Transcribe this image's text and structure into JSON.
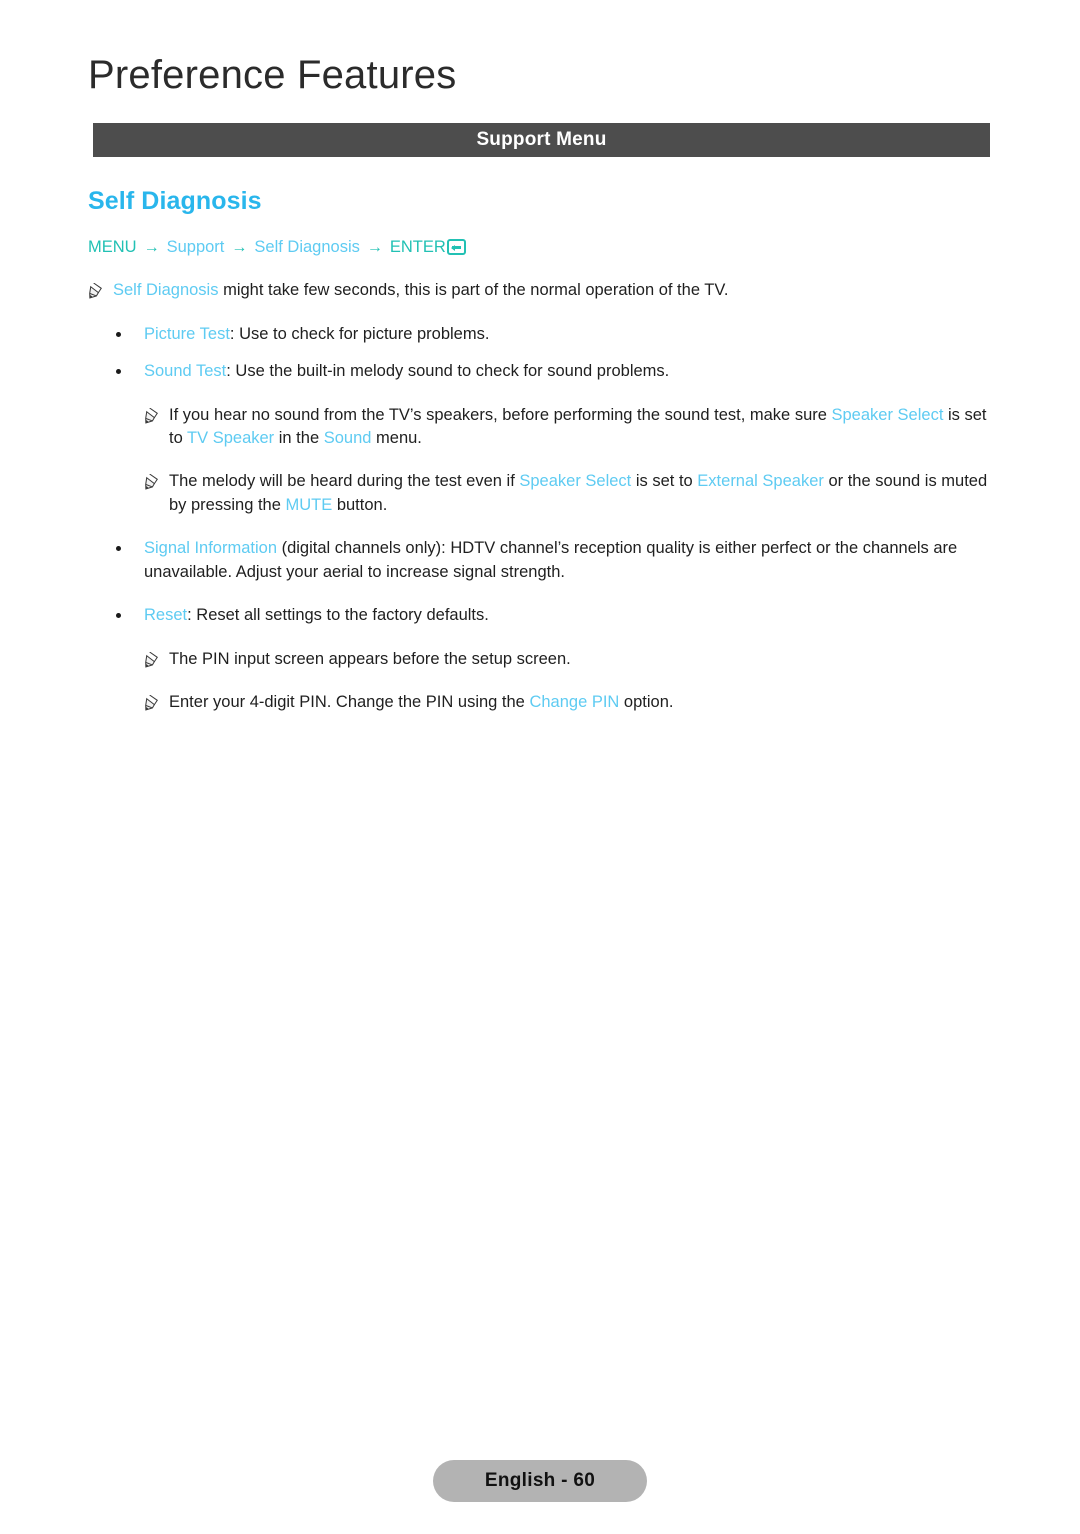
{
  "page": {
    "title": "Preference Features",
    "section_bar_label": "Support Menu",
    "footer_label": "English - 60",
    "accent_heading_color": "#29b6ec",
    "accent_link_color": "#5ecbf2",
    "accent_teal_color": "#22c1b4",
    "bar_color": "#4d4d4d",
    "footer_pill_color": "#b3b3b3"
  },
  "topic": {
    "heading": "Self Diagnosis",
    "breadcrumb": {
      "menu": "MENU",
      "arrow": "→",
      "step2": "Support",
      "step3": "Self Diagnosis",
      "enter": "ENTER",
      "enter_icon": "enter-key-icon"
    }
  },
  "notes": {
    "n1_a": "Self Diagnosis",
    "n1_b": " might take few seconds, this is part of the normal operation of the TV.",
    "n2_a": "If you hear no sound from the TV’s speakers, before performing the sound test, make sure ",
    "n2_b": "Speaker Select",
    "n2_c": " is set to ",
    "n2_d": "TV Speaker",
    "n2_e": " in the ",
    "n2_f": "Sound",
    "n2_g": " menu.",
    "n3_a": "The melody will be heard during the test even if ",
    "n3_b": "Speaker Select",
    "n3_c": " is set to ",
    "n3_d": "External Speaker",
    "n3_e": " or the sound is muted by pressing the ",
    "n3_f": "MUTE",
    "n3_g": " button.",
    "n4": "The PIN input screen appears before the setup screen.",
    "n5_a": "Enter your 4-digit PIN. Change the PIN using the ",
    "n5_b": "Change PIN",
    "n5_c": " option."
  },
  "bullets": {
    "b1_a": "Picture Test",
    "b1_b": ": Use to check for picture problems.",
    "b2_a": "Sound Test",
    "b2_b": ": Use the built-in melody sound to check for sound problems.",
    "b3_a": "Signal Information",
    "b3_b": " (digital channels only): HDTV channel’s reception quality is either perfect or the channels are unavailable. Adjust your aerial to increase signal strength.",
    "b4_a": "Reset",
    "b4_b": ": Reset all settings to the factory defaults."
  }
}
